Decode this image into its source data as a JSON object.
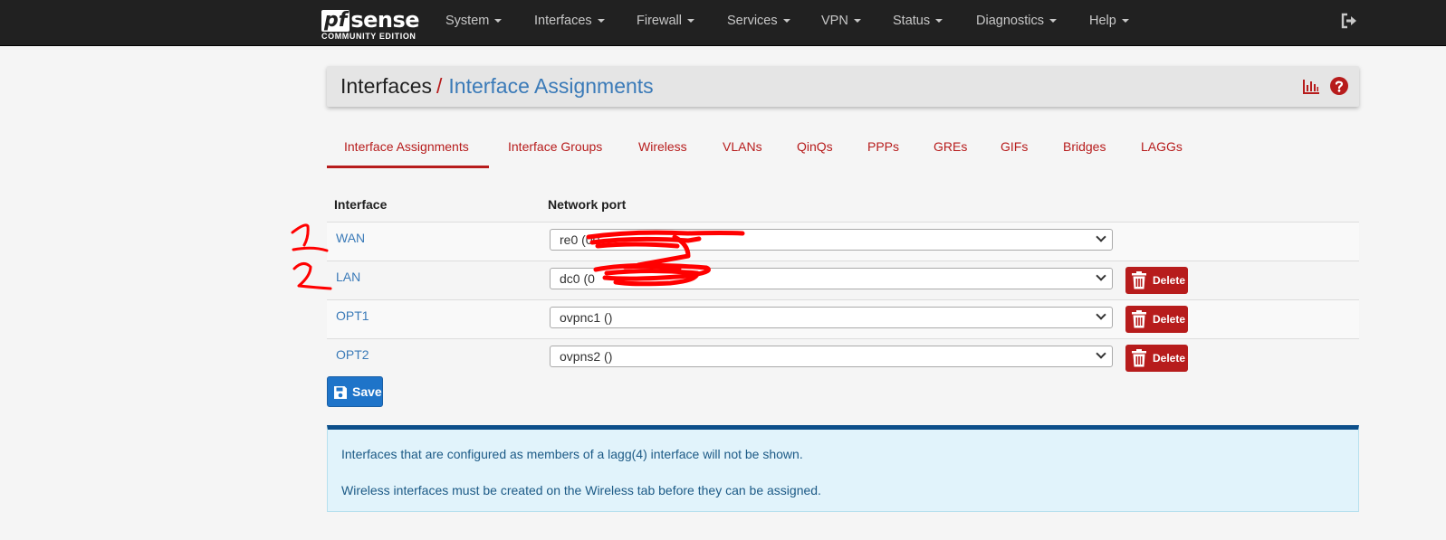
{
  "navbar": {
    "brand_pf": "pf",
    "brand_sense": "sense",
    "brand_edition": "COMMUNITY EDITION",
    "items": [
      {
        "label": "System"
      },
      {
        "label": "Interfaces"
      },
      {
        "label": "Firewall"
      },
      {
        "label": "Services"
      },
      {
        "label": "VPN"
      },
      {
        "label": "Status"
      },
      {
        "label": "Diagnostics"
      },
      {
        "label": "Help"
      }
    ],
    "logout_icon": "logout-icon"
  },
  "breadcrumb": {
    "root": "Interfaces",
    "separator": "/",
    "current": "Interface Assignments",
    "icons": [
      "chart-icon",
      "help-icon"
    ]
  },
  "tabs": [
    {
      "label": "Interface Assignments",
      "active": true
    },
    {
      "label": "Interface Groups"
    },
    {
      "label": "Wireless"
    },
    {
      "label": "VLANs"
    },
    {
      "label": "QinQs"
    },
    {
      "label": "PPPs"
    },
    {
      "label": "GREs"
    },
    {
      "label": "GIFs"
    },
    {
      "label": "Bridges"
    },
    {
      "label": "LAGGs"
    }
  ],
  "table": {
    "headers": [
      "Interface",
      "Network port"
    ],
    "rows": [
      {
        "interface": "WAN",
        "port": "re0 (00",
        "delete": null
      },
      {
        "interface": "LAN",
        "port": "dc0 (0",
        "delete": "Delete"
      },
      {
        "interface": "OPT1",
        "port": "ovpnc1 ()",
        "delete": "Delete"
      },
      {
        "interface": "OPT2",
        "port": "ovpns2 ()",
        "delete": "Delete"
      }
    ]
  },
  "save_label": "Save",
  "info": {
    "line1": "Interfaces that are configured as members of a lagg(4) interface will not be shown.",
    "line2": "Wireless interfaces must be created on the Wireless tab before they can be assigned."
  },
  "colors": {
    "navbar_bg": "#212121",
    "accent_red": "#b71c1c",
    "link_blue": "#3a7ab8",
    "save_blue": "#1e74c9",
    "info_bg": "#e1f3fb",
    "info_border_top": "#0d4f8a"
  }
}
